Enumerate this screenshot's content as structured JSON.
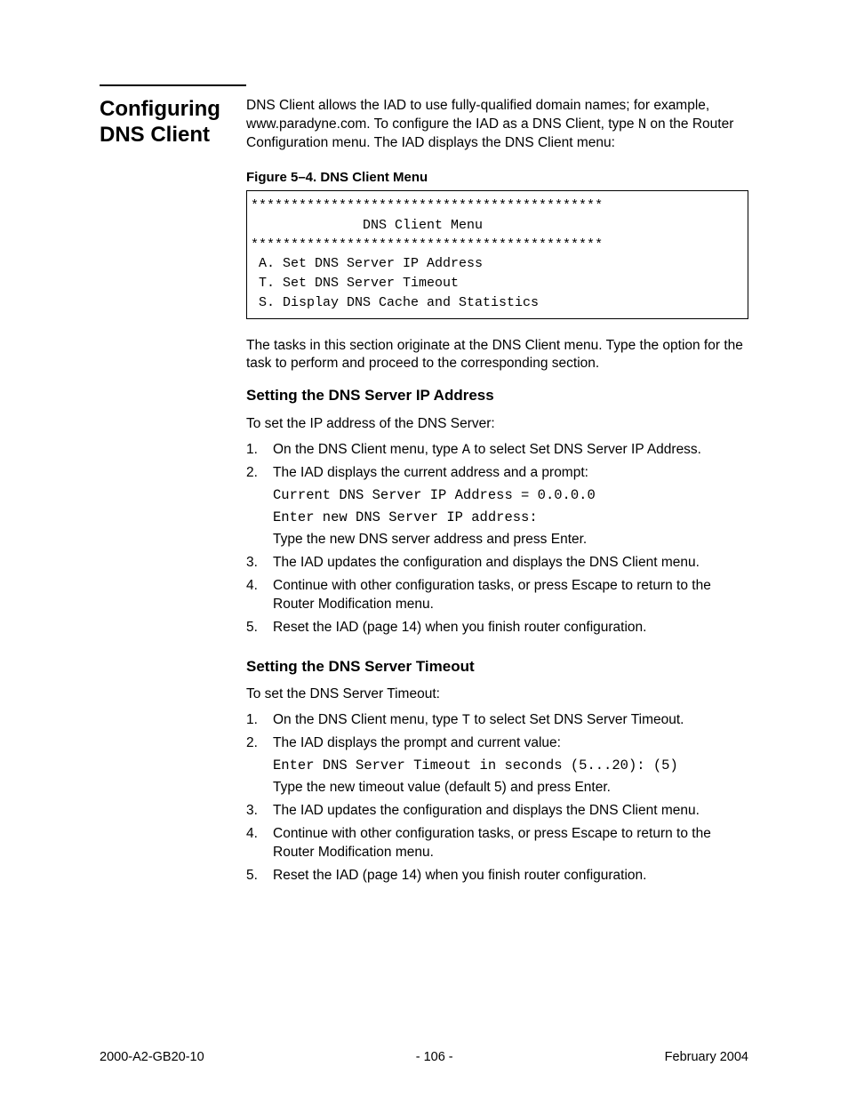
{
  "sideHeading": "Configur­ing DNS Client",
  "intro": {
    "part1": "DNS Client allows the IAD to use fully-qualified domain names; for example, www.paradyne.com. To configure the IAD as a DNS Client, type ",
    "code": "N",
    "part2": " on the Router Configuration menu. The IAD displays the DNS Client menu:"
  },
  "figureCaption": "Figure 5–4.  DNS Client Menu",
  "menuBox": {
    "line1": "********************************************",
    "line2": "              DNS Client Menu",
    "line3": "********************************************",
    "line4": " A. Set DNS Server IP Address",
    "line5": " T. Set DNS Server Timeout",
    "line6": " S. Display DNS Cache and Statistics"
  },
  "afterMenu": "The tasks in this section originate at the DNS Client menu. Type the option for the task to perform and proceed to the corresponding section.",
  "section1": {
    "heading": "Setting the DNS Server IP Address",
    "lead": "To set the IP address of the DNS Server:",
    "step1": {
      "pre": "On the DNS Client menu, type ",
      "code": "A",
      "post": " to select Set DNS Server IP Address."
    },
    "step2": {
      "lead": "The IAD displays the current address and a prompt:",
      "codeLine1": "Current DNS Server IP Address = 0.0.0.0",
      "codeLine2": "Enter new DNS Server IP address:",
      "tail": "Type the new DNS server address and press Enter."
    },
    "step3": "The IAD updates the configuration and displays the DNS Client menu.",
    "step4": "Continue with other configuration tasks, or press Escape to return to the Router Modification menu.",
    "step5": "Reset the IAD (page 14) when you finish router configuration."
  },
  "section2": {
    "heading": "Setting the DNS Server Timeout",
    "lead": "To set the DNS Server Timeout:",
    "step1": {
      "pre": "On the DNS Client menu, type ",
      "code": "T",
      "post": " to select Set DNS Server Timeout."
    },
    "step2": {
      "lead": "The IAD displays the prompt and current value:",
      "codeLine1": "Enter DNS Server Timeout in seconds (5...20): (5)",
      "tail": "Type the new timeout value (default 5) and press Enter."
    },
    "step3": "The IAD updates the configuration and displays the DNS Client menu.",
    "step4": "Continue with other configuration tasks, or press Escape to return to the Router Modification menu.",
    "step5": "Reset the IAD (page 14) when you finish router configuration."
  },
  "footer": {
    "left": "2000-A2-GB20-10",
    "center": "- 106 -",
    "right": "February 2004"
  }
}
